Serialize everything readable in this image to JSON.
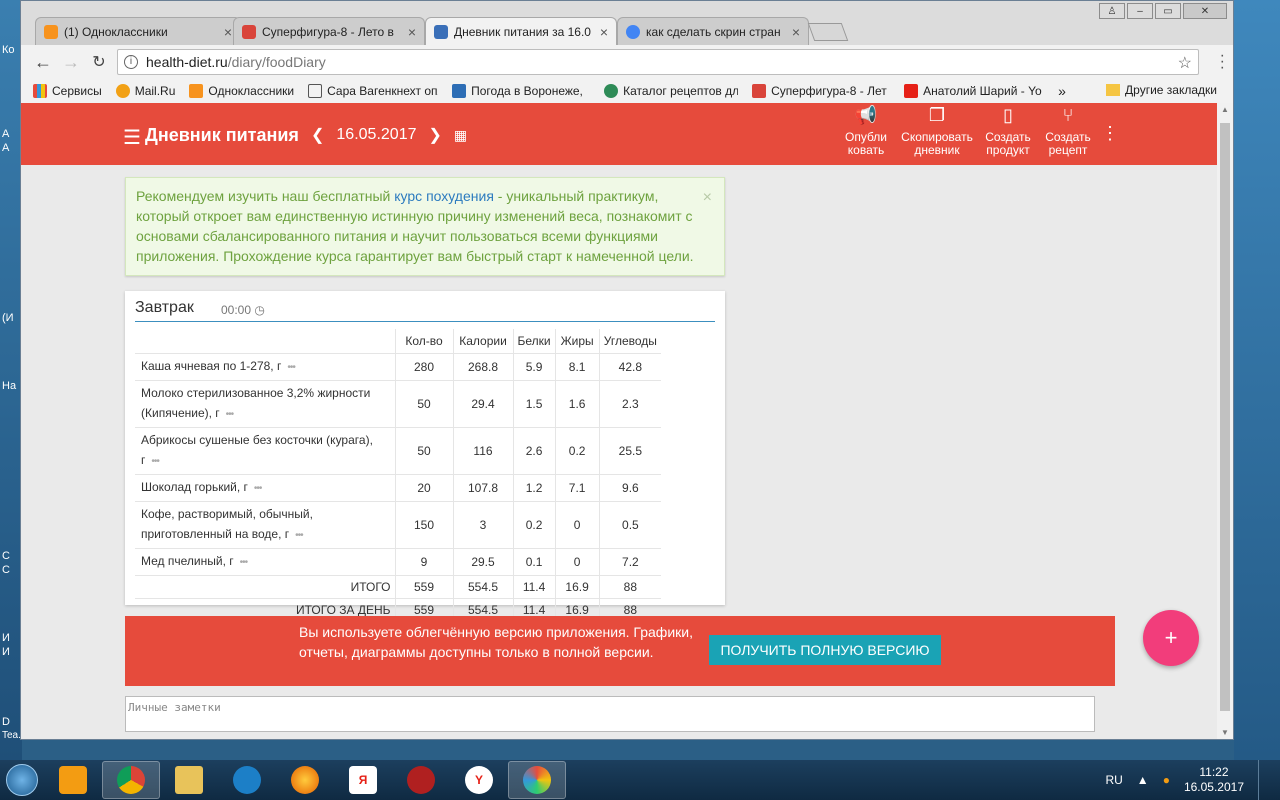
{
  "desktop": {
    "labels": [
      "Ко",
      "А",
      "А",
      "(И",
      "На",
      "С",
      "С",
      "И",
      "И",
      "D",
      "Tea..."
    ]
  },
  "browser": {
    "tabs": [
      {
        "label": "(1) Одноклассники",
        "color": "#f7931e"
      },
      {
        "label": "Суперфигура-8 - Лето в",
        "color": "#d9443a"
      },
      {
        "label": "Дневник питания за 16.0",
        "color": "#3a6fb8"
      },
      {
        "label": "как сделать скрин стран",
        "color": "#4285f4"
      }
    ],
    "url_host": "health-diet.ru",
    "url_path": "/diary/foodDiary",
    "bookmarks": [
      "Сервисы",
      "Mail.Ru",
      "Одноклассники",
      "Сара Вагенкнехт опя",
      "Погода в Воронеже,",
      "Каталог рецептов дл",
      "Суперфигура-8 - Лет",
      "Анатолий Шарий - Yo"
    ],
    "bookmarks_more": "»",
    "other_bookmarks": "Другие закладки"
  },
  "app": {
    "title": "Дневник питания",
    "date": "16.05.2017",
    "actions": [
      {
        "label": "Опубли ковать",
        "icon": "megaphone-icon"
      },
      {
        "label": "Скопировать дневник",
        "icon": "copy-icon"
      },
      {
        "label": "Создать продукт",
        "icon": "document-icon"
      },
      {
        "label": "Создать рецепт",
        "icon": "fork-knife-icon"
      }
    ],
    "notice": {
      "pre": "Рекомендуем изучить наш бесплатный ",
      "link": "курс похудения",
      "post": " - уникальный практикум, который откроет вам единственную истинную причину изменений веса, познакомит с основами сбалансированного питания и научит пользоваться всеми функциями приложения. Прохождение курса гарантирует вам быстрый старт к намеченной цели.",
      "close": "×"
    },
    "meal": {
      "title": "Завтрак",
      "time": "00:00",
      "columns": [
        "Кол-во",
        "Калории",
        "Белки",
        "Жиры",
        "Углеводы"
      ],
      "rows": [
        {
          "name": "Каша ячневая по 1-278, г",
          "qty": "280",
          "kcal": "268.8",
          "protein": "5.9",
          "fat": "8.1",
          "carbs": "42.8"
        },
        {
          "name": "Молоко стерилизованное 3,2% жирности (Кипячение), г",
          "qty": "50",
          "kcal": "29.4",
          "protein": "1.5",
          "fat": "1.6",
          "carbs": "2.3"
        },
        {
          "name": "Абрикосы сушеные без косточки (курага), г",
          "qty": "50",
          "kcal": "116",
          "protein": "2.6",
          "fat": "0.2",
          "carbs": "25.5"
        },
        {
          "name": "Шоколад горький, г",
          "qty": "20",
          "kcal": "107.8",
          "protein": "1.2",
          "fat": "7.1",
          "carbs": "9.6"
        },
        {
          "name": "Кофе, растворимый, обычный, приготовленный на воде, г",
          "qty": "150",
          "kcal": "3",
          "protein": "0.2",
          "fat": "0",
          "carbs": "0.5"
        },
        {
          "name": "Мед пчелиный, г",
          "qty": "9",
          "kcal": "29.5",
          "protein": "0.1",
          "fat": "0",
          "carbs": "7.2"
        }
      ],
      "totals": [
        {
          "label": "ИТОГО",
          "qty": "559",
          "kcal": "554.5",
          "protein": "11.4",
          "fat": "16.9",
          "carbs": "88"
        },
        {
          "label": "ИТОГО ЗА ДЕНЬ",
          "qty": "559",
          "kcal": "554.5",
          "protein": "11.4",
          "fat": "16.9",
          "carbs": "88"
        }
      ]
    },
    "promo": {
      "text": "Вы используете облегчённую версию приложения. Графики, отчеты, диаграммы доступны только в полной версии.",
      "button": "ПОЛУЧИТЬ ПОЛНУЮ ВЕРСИЮ"
    },
    "fab": "+",
    "notes_placeholder": "Личные заметки"
  },
  "taskbar": {
    "lang": "RU",
    "time": "11:22",
    "date": "16.05.2017"
  },
  "colors": {
    "brand": "#e64b3c",
    "accent_button": "#1aa3b5",
    "fab": "#f23d7b"
  }
}
